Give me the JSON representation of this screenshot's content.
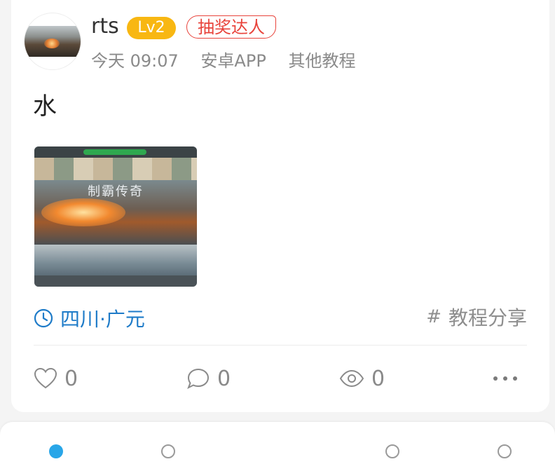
{
  "post": {
    "author": {
      "name": "rts",
      "level": "Lv2",
      "title_badge": "抽奖达人"
    },
    "meta": {
      "time": "今天 09:07",
      "source": "安卓APP",
      "category": "其他教程"
    },
    "content": "水",
    "image": {
      "caption": "制霸传奇"
    },
    "location": "四川·广元",
    "topic_hash": "#",
    "topic": "教程分享",
    "stats": {
      "likes": "0",
      "comments": "0",
      "views": "0"
    }
  },
  "colors": {
    "accent": "#1e7bc8",
    "level_badge": "#f8b712",
    "title_badge": "#e8433b",
    "tab_active": "#29a6e8"
  },
  "icons": {
    "location": "clock-icon",
    "like": "heart-icon",
    "comment": "speech-bubble-icon",
    "views": "eye-icon",
    "more": "ellipsis-icon"
  }
}
